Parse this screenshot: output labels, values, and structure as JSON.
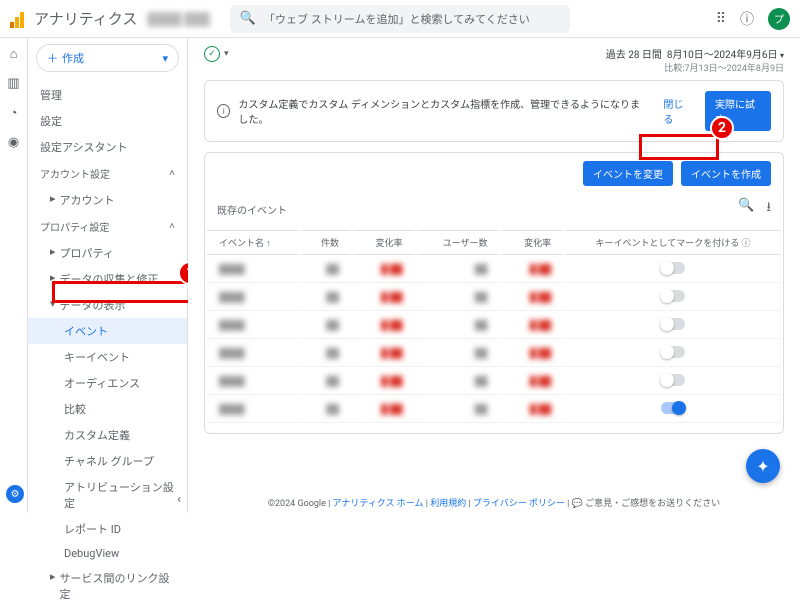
{
  "top": {
    "title": "アナリティクス",
    "property_blur": "████ ███",
    "search_placeholder": "「ウェブ ストリームを追加」と検索してみてください",
    "avatar_letter": "プ"
  },
  "sidebar": {
    "create_label": "作成",
    "sect_admin": "管理",
    "sect_settings": "設定",
    "sect_assistant": "設定アシスタント",
    "account_head": "アカウント設定",
    "account_item": "アカウント",
    "property_head": "プロパティ設定",
    "prop": {
      "property": "プロパティ",
      "data_collect": "データの収集と修正",
      "data_display": "データの表示",
      "events": "イベント",
      "key_events": "キーイベント",
      "audiences": "オーディエンス",
      "compare": "比較",
      "custom_def": "カスタム定義",
      "channel": "チャネル グループ",
      "attribution": "アトリビューション設定",
      "report_id": "レポート ID",
      "debugview": "DebugView",
      "service_link": "サービス間のリンク設定"
    }
  },
  "content": {
    "date_prefix": "過去 28 日間",
    "date_range": "8月10日〜2024年9月6日",
    "date_compare": "比較:7月13日〜2024年8月9日",
    "banner_text": "カスタム定義でカスタム ディメンションとカスタム指標を作成、管理できるようになりました。",
    "banner_close": "閉じる",
    "banner_try": "実際に試す",
    "btn_modify": "イベントを変更",
    "btn_create": "イベントを作成",
    "section_title": "既存のイベント",
    "table": {
      "cols": {
        "name": "イベント名 ↑",
        "count": "件数",
        "change1": "変化率",
        "users": "ユーザー数",
        "change2": "変化率",
        "mark": "キーイベントとしてマークを付ける"
      }
    }
  },
  "footer": {
    "copyright": "©2024 Google",
    "links": {
      "home": "アナリティクス ホーム",
      "terms": "利用規約",
      "privacy": "プライバシー ポリシー"
    },
    "feedback": "ご意見・ご感想をお送りください"
  },
  "chart_data": {
    "type": "table",
    "columns": [
      "イベント名",
      "件数",
      "変化率",
      "ユーザー数",
      "変化率",
      "キーイベント"
    ],
    "rows": [
      {
        "name_hidden": true,
        "toggle": false
      },
      {
        "name_hidden": true,
        "toggle": false
      },
      {
        "name_hidden": true,
        "toggle": false
      },
      {
        "name_hidden": true,
        "toggle": false
      },
      {
        "name_hidden": true,
        "toggle": false
      },
      {
        "name_hidden": true,
        "toggle": true
      }
    ],
    "note": "numeric values redacted/blurred in source"
  }
}
